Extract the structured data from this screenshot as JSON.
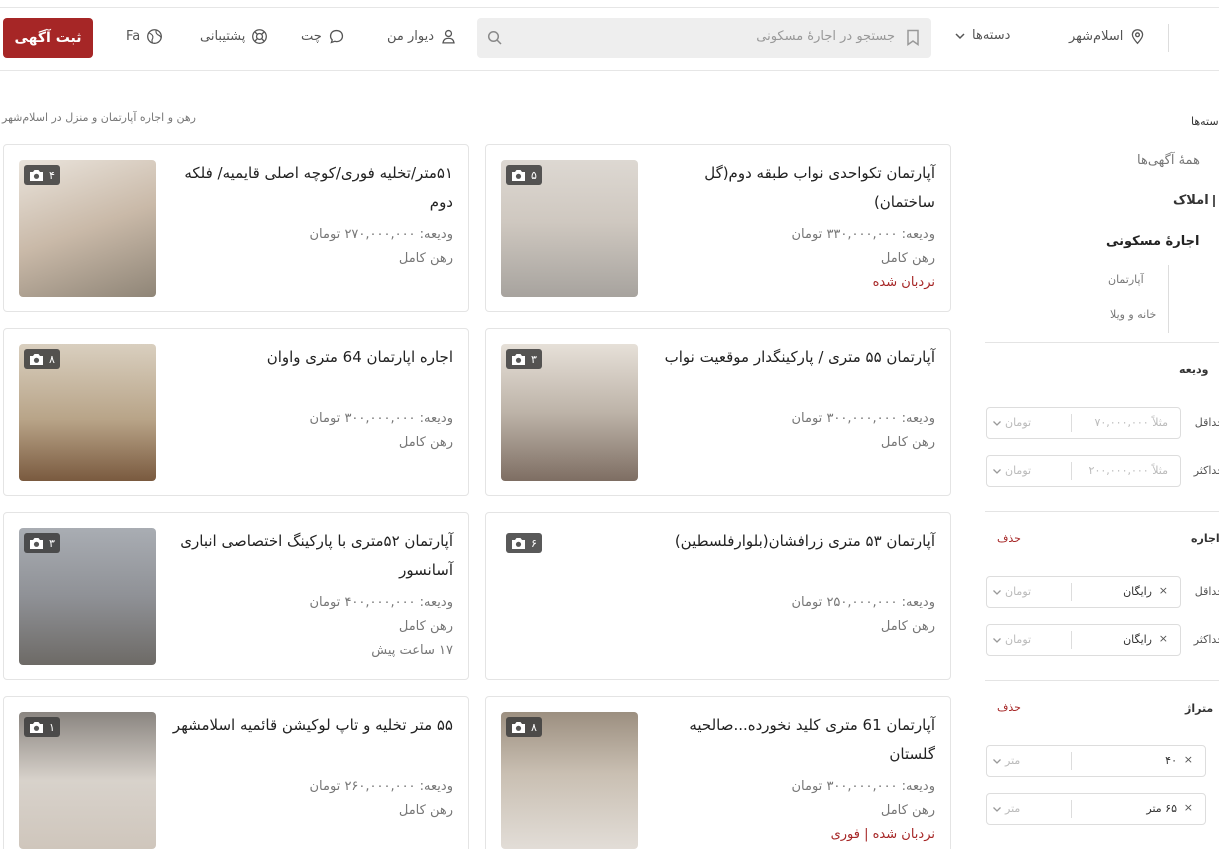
{
  "header": {
    "post_label": "ثبت آگهی",
    "lang_label": "Fa",
    "support_label": "پشتیبانی",
    "chat_label": "چت",
    "mydivar_label": "دیوار من",
    "search_placeholder": "جستجو در اجارهٔ مسکونی",
    "categories_label": "دسته‌ها",
    "city_label": "اسلام‌شهر"
  },
  "breadcrumb": "رهن و اجاره آپارتمان و منزل در اسلام‌شهر",
  "listings": [
    {
      "title": "آپارتمان تکواحدی نواب طبقه دوم(گل ساختمان)",
      "deposit": "ودیعه: ۳۳۰,۰۰۰,۰۰۰ تومان",
      "rent": "رهن کامل",
      "extra": "نردبان شده",
      "photos": "۵"
    },
    {
      "title": "۵۱متر/تخلیه فوری/کوچه اصلی قایمیه/ فلکه دوم",
      "deposit": "ودیعه: ۲۷۰,۰۰۰,۰۰۰ تومان",
      "rent": "رهن کامل",
      "extra": "",
      "photos": "۴"
    },
    {
      "title": "آپارتمان ۵۵ متری / پارکینگدار موقعیت نواب",
      "deposit": "ودیعه: ۳۰۰,۰۰۰,۰۰۰ تومان",
      "rent": "رهن کامل",
      "extra": "",
      "photos": "۳"
    },
    {
      "title": "اجاره اپارتمان 64 متری واوان",
      "deposit": "ودیعه: ۳۰۰,۰۰۰,۰۰۰ تومان",
      "rent": "رهن کامل",
      "extra": "",
      "photos": "۸"
    },
    {
      "title": "آپارتمان ۵۳ متری زرافشان(بلوارفلسطین)",
      "deposit": "ودیعه: ۲۵۰,۰۰۰,۰۰۰ تومان",
      "rent": "رهن کامل",
      "extra": "",
      "photos": "۶"
    },
    {
      "title": "آپارتمان ۵۲متری با پارکینگ اختصاصی انباری آسانسور",
      "deposit": "ودیعه: ۴۰۰,۰۰۰,۰۰۰ تومان",
      "rent": "رهن کامل",
      "extra": "۱۷ ساعت پیش",
      "photos": "۳"
    },
    {
      "title": "آپارتمان 61 متری کلید نخورده...صالحیه گلستان",
      "deposit": "ودیعه: ۳۰۰,۰۰۰,۰۰۰ تومان",
      "rent": "رهن کامل",
      "extra": "نردبان شده | فوری",
      "photos": "۸"
    },
    {
      "title": "۵۵ متر تخلیه و تاپ لوکیشن قائمیه اسلامشهر",
      "deposit": "ودیعه: ۲۶۰,۰۰۰,۰۰۰ تومان",
      "rent": "رهن کامل",
      "extra": "",
      "photos": "۱"
    }
  ],
  "sidebar": {
    "categories_heading": "دسته‌ها",
    "all_ads": "همهٔ آگهی‌ها",
    "real_estate": "املاک",
    "residential_rent": "اجارهٔ مسکونی",
    "apartment": "آپارتمان",
    "house_villa": "خانه و ویلا",
    "deposit_heading": "ودیعه",
    "min_label": "حداقل",
    "max_label": "حداکثر",
    "deposit_min_placeholder": "مثلاً ۷۰,۰۰۰,۰۰۰",
    "deposit_max_placeholder": "مثلاً ۲۰۰,۰۰۰,۰۰۰",
    "unit_toman": "تومان",
    "rent_heading": "اجاره",
    "delete_label": "حذف",
    "rent_min_value": "رایگان",
    "rent_max_value": "رایگان",
    "area_heading": "متراژ",
    "area_min_value": "۴۰",
    "area_max_value": "۶۵ متر",
    "unit_meter": "متر"
  }
}
